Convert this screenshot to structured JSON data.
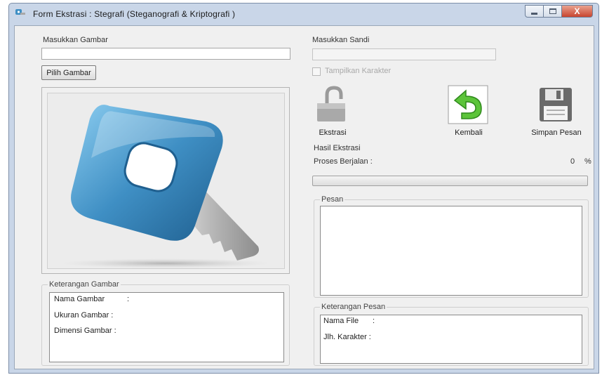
{
  "window": {
    "title": "Form Ekstrasi : Stegrafi (Steganografi & Kriptografi )",
    "close_glyph": "X"
  },
  "left": {
    "image_label": "Masukkan Gambar",
    "image_path": "",
    "choose_button": "Pilih Gambar",
    "image_info_title": "Keterangan Gambar",
    "image_name_label": "Nama Gambar",
    "image_name_sep": ":",
    "image_size_label": "Ukuran Gambar :",
    "image_dim_label": "Dimensi Gambar :"
  },
  "right": {
    "password_label": "Masukkan Sandi",
    "password_value": "",
    "show_chars_label": "Tampilkan Karakter",
    "show_chars_checked": false,
    "tools": {
      "extract": "Ekstrasi",
      "back": "Kembali",
      "save": "Simpan Pesan"
    },
    "result_title": "Hasil Ekstrasi",
    "process_label": "Proses Berjalan :",
    "progress_value": "0",
    "progress_unit": "%",
    "progress_fraction": 0.0,
    "message_title": "Pesan",
    "message_text": "",
    "msg_info_title": "Keterangan Pesan",
    "file_name_label": "Nama File",
    "file_name_sep": ":",
    "char_count_label": "Jlh. Karakter :"
  },
  "colors": {
    "key_blue": "#3f8fc4",
    "arrow_green": "#5cc43a",
    "close_red": "#c8452f"
  },
  "icons": {
    "title": "key-app-icon",
    "image": "key-illustration",
    "extract": "unlocked-padlock-icon",
    "back": "green-return-arrow-icon",
    "save": "floppy-disk-icon"
  }
}
